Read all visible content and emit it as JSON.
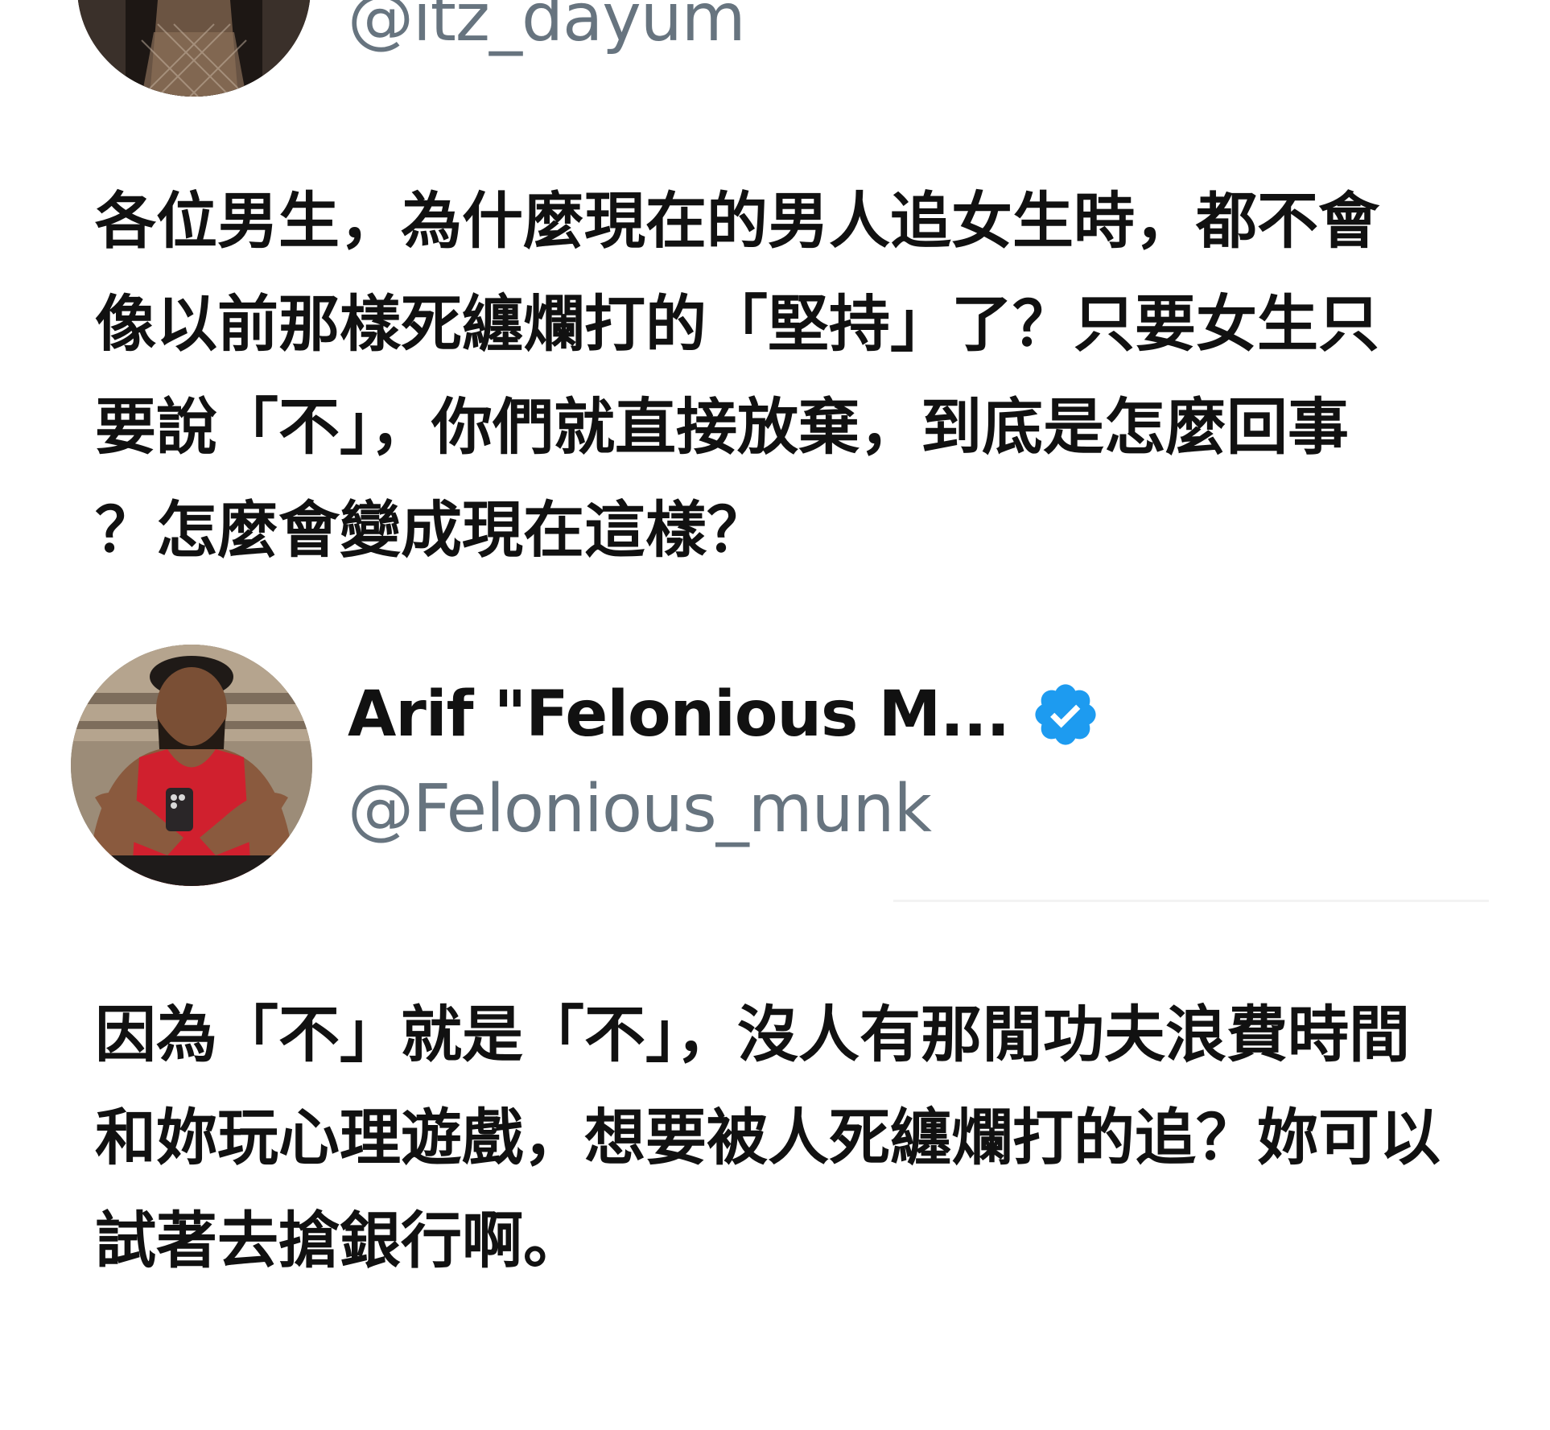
{
  "post1": {
    "handle": "@itz_dayum",
    "body_lines": [
      "各位男生，為什麼現在的男人追女生時，都不會",
      "像以前那樣死纏爛打的「堅持」了？只要女生只",
      "要說「不」，你們就直接放棄，到底是怎麼回事",
      "？怎麼會變成現在這樣？"
    ]
  },
  "post2": {
    "display_name": "Arif \"Felonious M...",
    "verified_icon": "verified-badge-icon",
    "handle": "@Felonious_munk",
    "body_lines": [
      "因為「不」就是「不」，沒人有那閒功夫浪費時間",
      "和妳玩心理遊戲，想要被人死纏爛打的追？妳可以",
      "試著去搶銀行啊。"
    ]
  },
  "colors": {
    "handle": "#67747f",
    "text": "#111111",
    "verified": "#1d9bf0",
    "background": "#ffffff"
  }
}
